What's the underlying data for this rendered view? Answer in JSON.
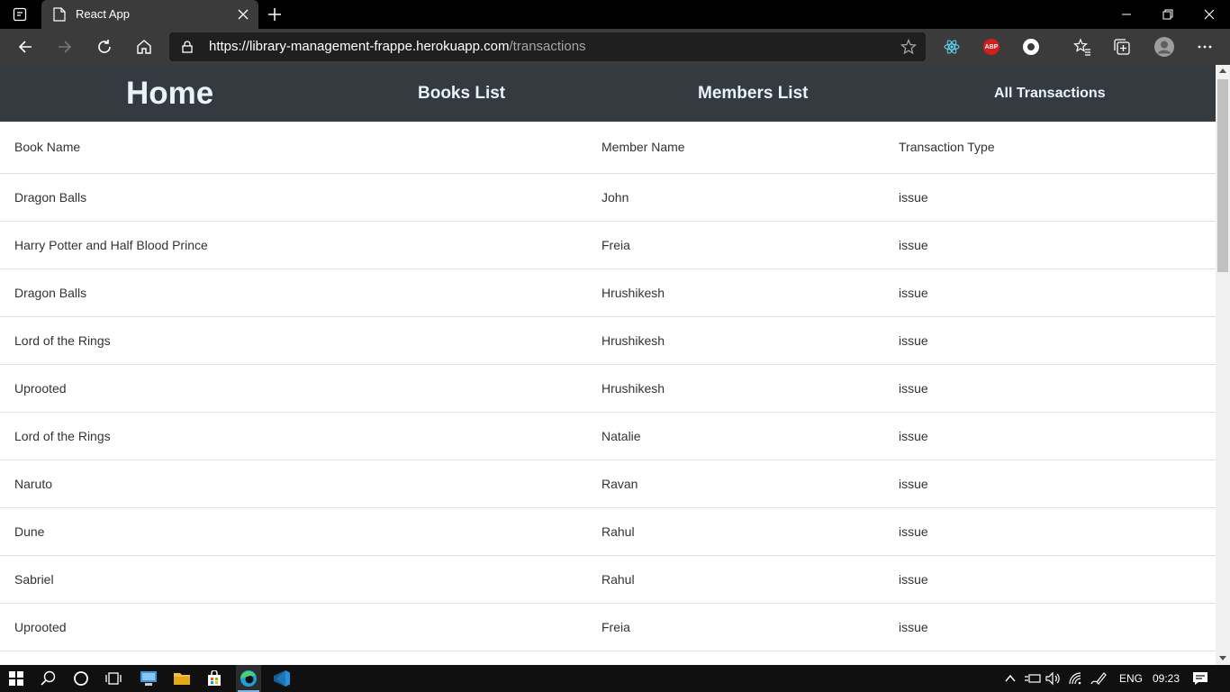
{
  "browser": {
    "tab_title": "React App",
    "url_host": "https://library-management-frappe.herokuapp.com",
    "url_path": "/transactions"
  },
  "nav": {
    "home": "Home",
    "books": "Books List",
    "members": "Members List",
    "transactions": "All Transactions"
  },
  "table": {
    "headers": [
      "Book Name",
      "Member Name",
      "Transaction Type"
    ],
    "rows": [
      [
        "Dragon Balls",
        "John",
        "issue"
      ],
      [
        "Harry Potter and Half Blood Prince",
        "Freia",
        "issue"
      ],
      [
        "Dragon Balls",
        "Hrushikesh",
        "issue"
      ],
      [
        "Lord of the Rings",
        "Hrushikesh",
        "issue"
      ],
      [
        "Uprooted",
        "Hrushikesh",
        "issue"
      ],
      [
        "Lord of the Rings",
        "Natalie",
        "issue"
      ],
      [
        "Naruto",
        "Ravan",
        "issue"
      ],
      [
        "Dune",
        "Rahul",
        "issue"
      ],
      [
        "Sabriel",
        "Rahul",
        "issue"
      ],
      [
        "Uprooted",
        "Freia",
        "issue"
      ]
    ]
  },
  "taskbar": {
    "language": "ENG",
    "time": "09:23"
  },
  "extensions": {
    "abp_label": "ABP"
  },
  "colors": {
    "nav_bg": "#343a40",
    "nav_text": "#e8f4fb",
    "browser_dark": "#3b3b3b"
  }
}
